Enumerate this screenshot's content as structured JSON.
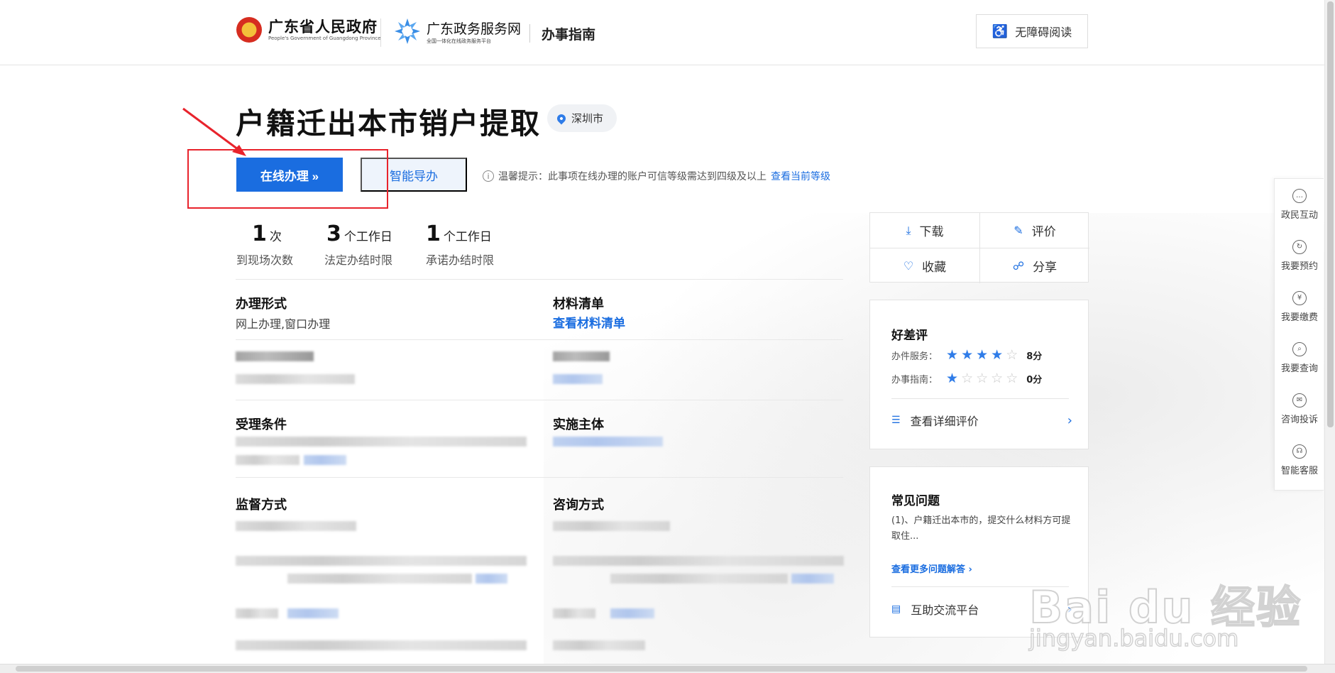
{
  "header": {
    "gov_name": "广东省人民政府",
    "gov_en": "People's Government of Guangdong Province",
    "portal_name": "广东政务服务网",
    "portal_sub": "全国一体化在线政务服务平台",
    "section_title": "办事指南",
    "accessibility_label": "无障碍阅读"
  },
  "main": {
    "title": "户籍迁出本市销户提取",
    "location": "深圳市",
    "online_button": "在线办理 »",
    "guide_button": "智能导办",
    "tip_text": "温馨提示：此事项在线办理的账户可信等级需达到四级及以上",
    "tip_link": "查看当前等级"
  },
  "stats": [
    {
      "num": "1",
      "unit": "次",
      "label": "到现场次数"
    },
    {
      "num": "3",
      "unit": "个工作日",
      "label": "法定办结时限"
    },
    {
      "num": "1",
      "unit": "个工作日",
      "label": "承诺办结时限"
    }
  ],
  "fields": {
    "handling_form_label": "办理形式",
    "handling_form_value": "网上办理,窗口办理",
    "materials_label": "材料清单",
    "materials_link": "查看材料清单",
    "conditions_label": "受理条件",
    "implementer_label": "实施主体",
    "supervision_label": "监督方式",
    "consult_label": "咨询方式"
  },
  "actions": {
    "download": "下载",
    "evaluate": "评价",
    "favorite": "收藏",
    "share": "分享"
  },
  "ratings": {
    "title": "好差评",
    "service_label": "办件服务：",
    "service_stars": 4,
    "service_score": "8分",
    "guide_label": "办事指南：",
    "guide_stars": 1,
    "guide_score": "0分",
    "detail_link": "查看详细评价"
  },
  "faq": {
    "title": "常见问题",
    "question": "(1)、户籍迁出本市的，提交什么材料方可提取住...",
    "more_link": "查看更多问题解答",
    "platform_link": "互助交流平台"
  },
  "sidebar": {
    "items": [
      {
        "label": "政民互动",
        "glyph": "…"
      },
      {
        "label": "我要预约",
        "glyph": "↻"
      },
      {
        "label": "我要缴费",
        "glyph": "¥"
      },
      {
        "label": "我要查询",
        "glyph": "⌕"
      },
      {
        "label": "咨询投诉",
        "glyph": "✉"
      },
      {
        "label": "智能客服",
        "glyph": "☊"
      }
    ]
  },
  "watermark": {
    "text": "Bai du 经验",
    "url": "jingyan.baidu.com"
  },
  "colors": {
    "primary": "#1a6de0",
    "highlight_box": "#e8232c"
  }
}
